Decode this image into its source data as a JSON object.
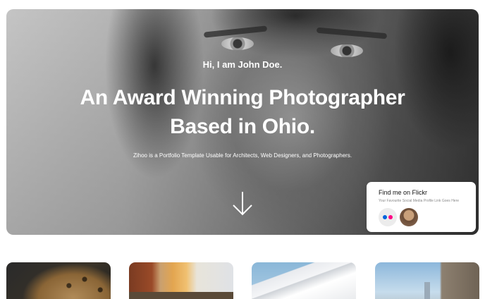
{
  "hero": {
    "greeting": "Hi, I am John Doe.",
    "title_line1": "An Award Winning Photographer",
    "title_line2": "Based in Ohio.",
    "subtitle": "Zihoo is a Portfolio Template Usable for Architects, Web Designers, and Photographers.",
    "scroll_icon": "arrow-down-icon"
  },
  "flickr_card": {
    "title": "Find me on Flickr",
    "subtitle": "Your Favourite Social Media Profile Link Goes Here",
    "logo_icon": "flickr-logo-icon",
    "flickr_colors": [
      "#0063dc",
      "#ff0084"
    ]
  },
  "portfolio": {
    "cards": [
      {
        "name": "leopard-photo"
      },
      {
        "name": "city-street-photo"
      },
      {
        "name": "architecture-photo"
      },
      {
        "name": "bridge-photo"
      }
    ]
  }
}
